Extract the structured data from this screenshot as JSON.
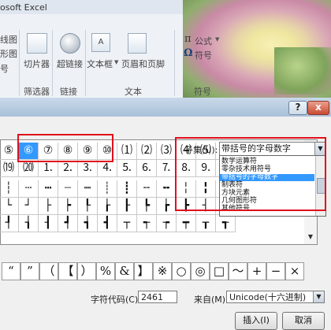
{
  "window": {
    "title": "osoft Excel"
  },
  "ribbon": {
    "left_labels": [
      "线图",
      "形图",
      "号"
    ],
    "items": [
      {
        "label": "切片器"
      },
      {
        "label": "超链接"
      },
      {
        "label": "文本框"
      },
      {
        "label": "页眉和页脚"
      }
    ],
    "groups": [
      "筛选器",
      "链接",
      "文本",
      "符号"
    ],
    "equation_label": "公式",
    "symbol_label": "符号"
  },
  "dialog": {
    "help": "?",
    "close": "x",
    "subset_label": "子集(U):",
    "subset_value": "带括号的字母数字",
    "subset_options": [
      "数学运算符",
      "零杂技术用符号",
      "带括号的字母数字",
      "制表符",
      "方块元素",
      "几何图形符",
      "其他符号"
    ],
    "selected_option": 2,
    "grid_rows": [
      [
        "⑤",
        "⑥",
        "⑦",
        "⑧",
        "⑨",
        "⑩",
        "⑴",
        "⑵",
        "⑶",
        "⑷",
        "⑸",
        "⑹"
      ],
      [
        "⒆",
        "⒇",
        "⒈",
        "⒉",
        "⒊",
        "⒋",
        "⒌",
        "⒍",
        "⒎",
        "⒏",
        "⒐",
        "⒑"
      ],
      [
        "┆",
        "┄",
        "┅",
        "┈",
        "┉",
        "┊",
        "┋",
        "╌",
        "╍",
        "╎",
        "╏",
        "┆"
      ],
      [
        "└",
        "┘",
        "├",
        "┝",
        "┞",
        "┟",
        "┠",
        "┡",
        "┢",
        "┣",
        "┤",
        "┥"
      ],
      [
        "┦",
        "┧",
        "┨",
        "┩",
        "┪",
        "┫",
        "┬",
        "┭",
        "┮",
        "┯",
        "┰",
        "┱"
      ]
    ],
    "recent_symbols": [
      "“",
      "”",
      "（",
      "【",
      "）",
      "%",
      "&",
      "】",
      "※",
      "○",
      "◎",
      "□",
      "〜",
      "+",
      "−",
      "×"
    ],
    "char_code_label": "字符代码(C):",
    "char_code_value": "2461",
    "from_label": "来自(M):",
    "from_value": "Unicode(十六进制)",
    "insert_label": "插入(I)",
    "cancel_label": "取消"
  }
}
